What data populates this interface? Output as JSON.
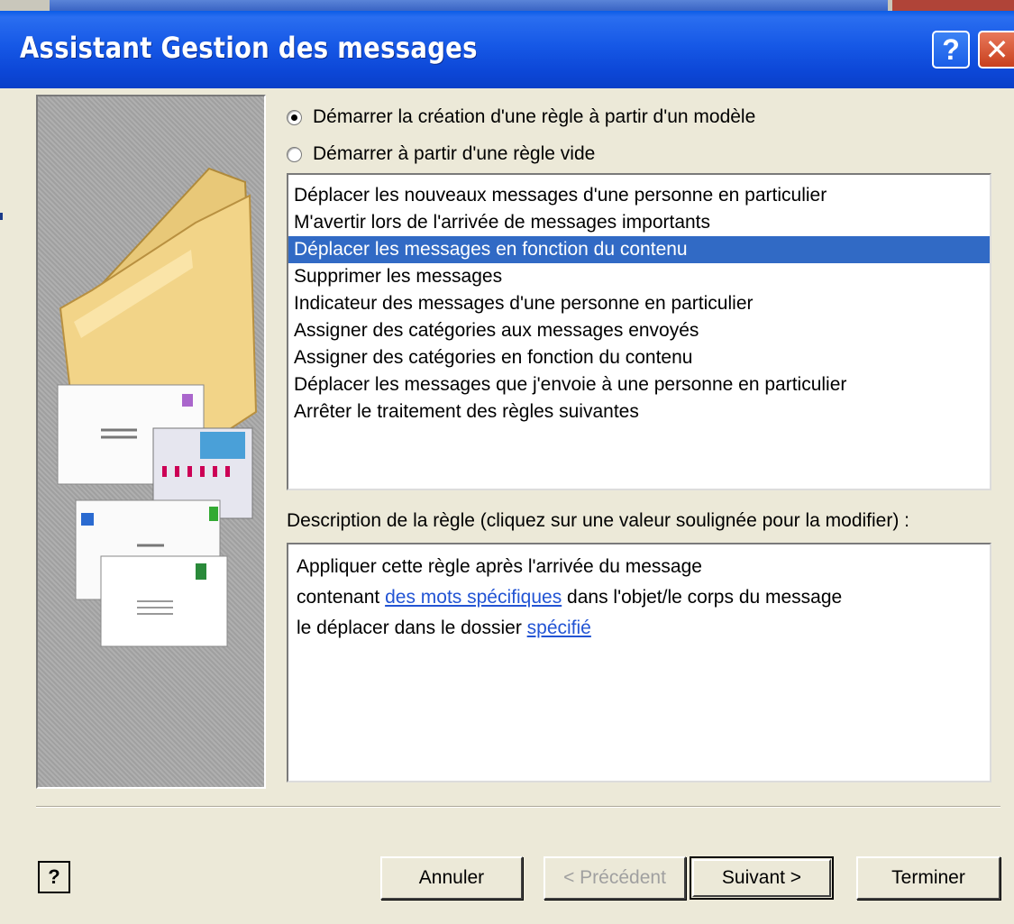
{
  "window": {
    "title": "Assistant Gestion des messages",
    "help_button": "?",
    "close_button": "✕"
  },
  "options": {
    "radio_template": "Démarrer la création d'une règle à partir d'un modèle",
    "radio_blank": "Démarrer à partir d'une règle vide",
    "selected": "template"
  },
  "templates": {
    "items": [
      "Déplacer les nouveaux messages d'une personne en particulier",
      "M'avertir lors de l'arrivée de messages importants",
      "Déplacer les messages en fonction du contenu",
      "Supprimer les messages",
      "Indicateur des messages d'une personne en particulier",
      "Assigner des catégories aux messages envoyés",
      "Assigner des catégories en fonction du contenu",
      "Déplacer les messages que j'envoie à une personne en particulier",
      "Arrêter le traitement des règles suivantes"
    ],
    "selected_index": 2
  },
  "description": {
    "label": "Description de la règle (cliquez sur une valeur soulignée pour la modifier) :",
    "line1": "Appliquer cette règle après l'arrivée du message",
    "line2_prefix": "contenant ",
    "line2_link": "des mots spécifiques",
    "line2_suffix": " dans l'objet/le corps du message",
    "line3_prefix": "le déplacer dans le dossier ",
    "line3_link": "spécifié"
  },
  "footer": {
    "help_icon": "?",
    "cancel": "Annuler",
    "back": "< Précédent",
    "next": "Suivant >",
    "finish": "Terminer"
  },
  "colors": {
    "titlebar": "#0a4fd8",
    "selection": "#316ac5",
    "link": "#2254d4",
    "dialog_bg": "#ece9d8"
  }
}
